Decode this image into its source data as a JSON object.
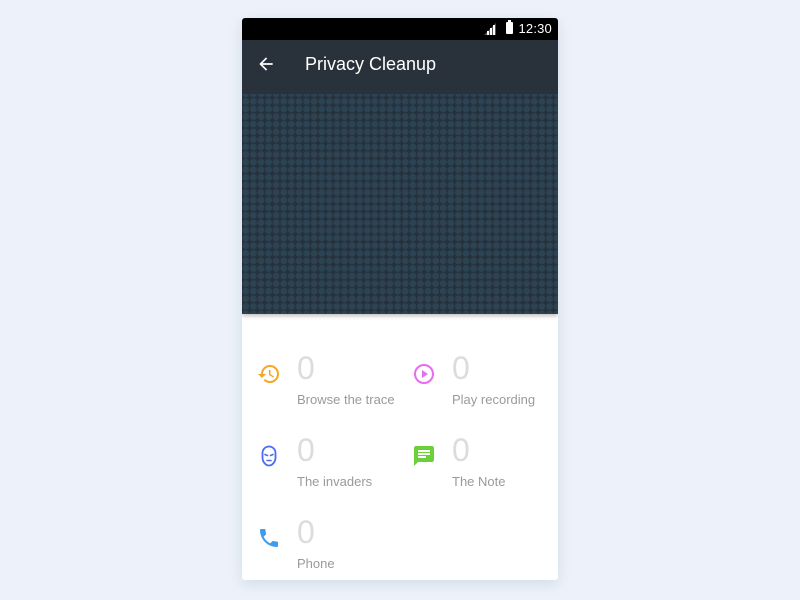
{
  "status_bar": {
    "time": "12:30",
    "signal_icon": "signal-icon",
    "battery_icon": "battery-icon"
  },
  "app_bar": {
    "title": "Privacy Cleanup",
    "back_icon": "arrow-back-icon"
  },
  "items": [
    {
      "label": "Browse the trace",
      "count": "0",
      "icon": "history-icon",
      "color": "#f5a623"
    },
    {
      "label": "Play recording",
      "count": "0",
      "icon": "play-circle-icon",
      "color": "#e86bf0"
    },
    {
      "label": "The invaders",
      "count": "0",
      "icon": "mask-icon",
      "color": "#4a6cf0"
    },
    {
      "label": "The Note",
      "count": "0",
      "icon": "message-icon",
      "color": "#6bd03a"
    },
    {
      "label": "Phone",
      "count": "0",
      "icon": "phone-icon",
      "color": "#3d9cf0"
    }
  ]
}
